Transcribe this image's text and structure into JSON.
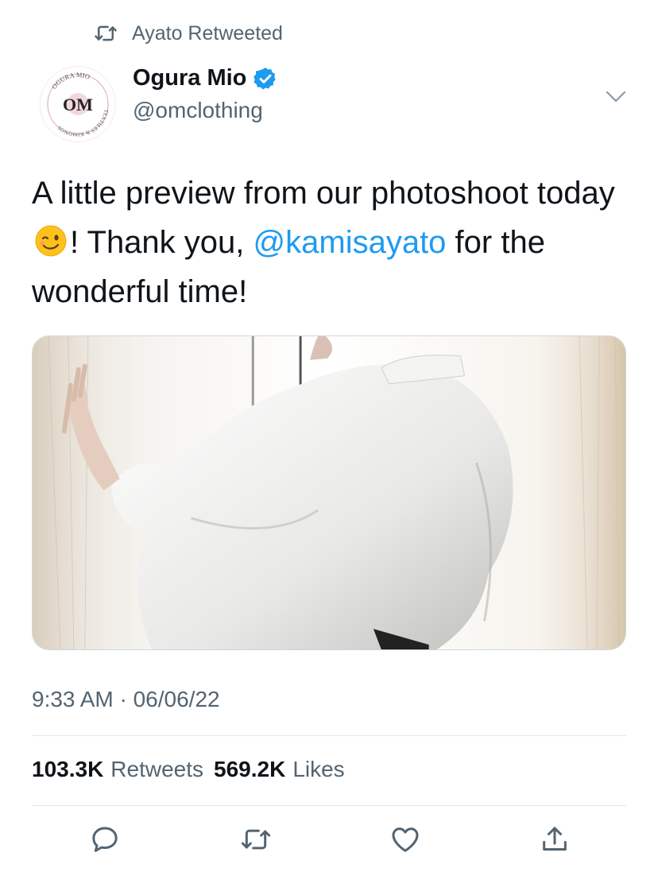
{
  "retweet": {
    "icon": "retweet-icon",
    "label": "Ayato Retweeted"
  },
  "author": {
    "name": "Ogura Mio",
    "handle": "@omclothing",
    "verified_icon": "verified-badge-icon",
    "avatar_logo_text": [
      "OGURA MIO",
      "TEXTILES & KIMONOS",
      "OM"
    ]
  },
  "tweet": {
    "text_part1": "A little preview from our photoshoot today ",
    "emoji": "😉",
    "text_part2": "! Thank you, ",
    "mention": "@kamisayato",
    "text_part3": " for the wonderful time!",
    "media": "photo of a person in a white satin blouse by a window with sheer curtains"
  },
  "meta": {
    "timestamp": "9:33 AM · 06/06/22"
  },
  "stats": {
    "retweets_count": "103.3K",
    "retweets_label": "Retweets",
    "likes_count": "569.2K",
    "likes_label": "Likes"
  },
  "actions": [
    "reply-icon",
    "retweet-icon",
    "like-icon",
    "share-icon"
  ],
  "colors": {
    "accent": "#1d9bf0",
    "secondary_text": "#536471",
    "primary_text": "#0f1419",
    "divider": "#e1e6ea"
  }
}
